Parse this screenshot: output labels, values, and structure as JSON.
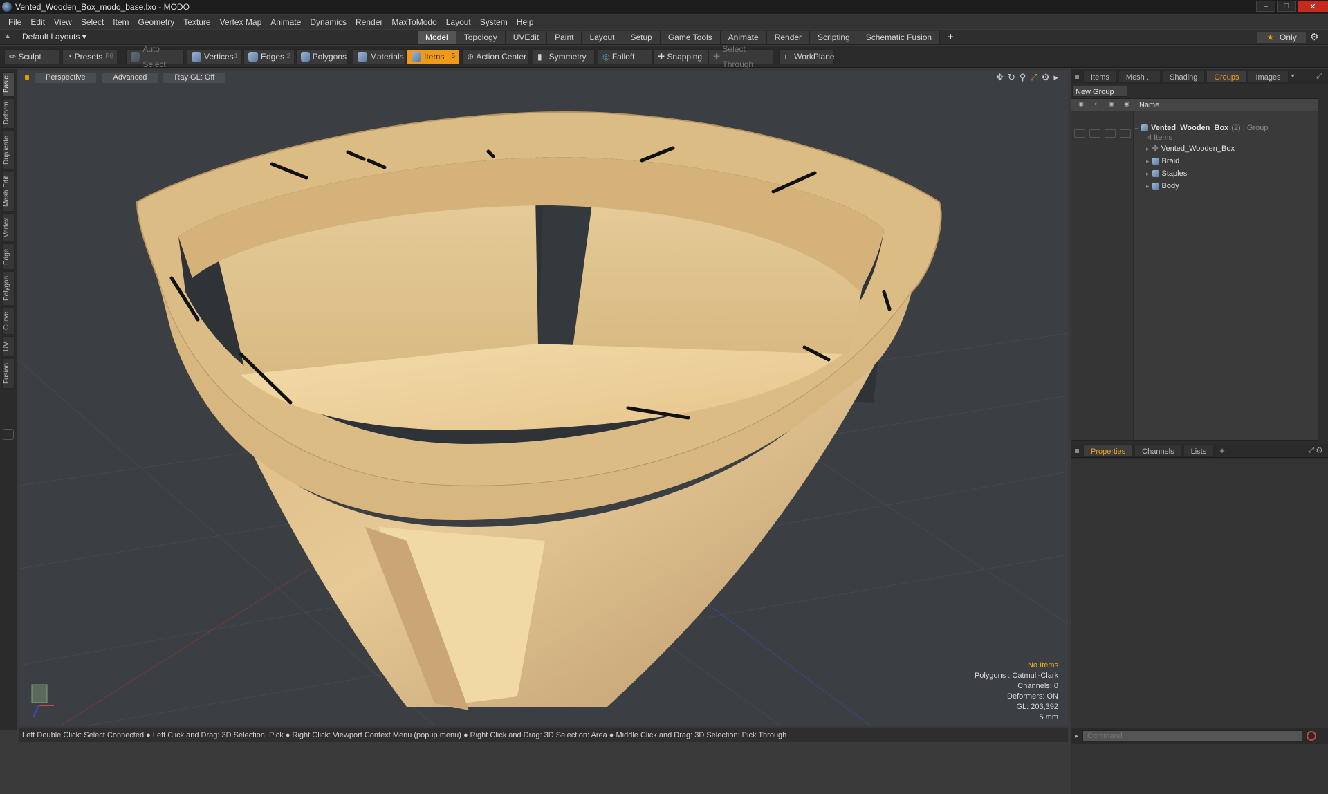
{
  "window": {
    "title": "Vented_Wooden_Box_modo_base.lxo - MODO"
  },
  "menu": [
    "File",
    "Edit",
    "View",
    "Select",
    "Item",
    "Geometry",
    "Texture",
    "Vertex Map",
    "Animate",
    "Dynamics",
    "Render",
    "MaxToModo",
    "Layout",
    "System",
    "Help"
  ],
  "layout": {
    "selector": "Default Layouts",
    "tabs": [
      "Model",
      "Topology",
      "UVEdit",
      "Paint",
      "Layout",
      "Setup",
      "Game Tools",
      "Animate",
      "Render",
      "Scripting",
      "Schematic Fusion"
    ],
    "active_tab": "Model",
    "only_label": "Only"
  },
  "toolbar": {
    "sculpt": "Sculpt",
    "presets": "Presets",
    "presets_key": "F6",
    "auto_select": "Auto Select",
    "vertices": "Vertices",
    "vertices_key": "1",
    "edges": "Edges",
    "edges_key": "2",
    "polygons": "Polygons",
    "materials": "Materials",
    "items": "Items",
    "items_key": "5",
    "action_center": "Action Center",
    "symmetry": "Symmetry",
    "falloff": "Falloff",
    "snapping": "Snapping",
    "select_through": "Select Through",
    "workplane": "WorkPlane"
  },
  "left_tabs": [
    "Basic",
    "Deform",
    "Duplicate",
    "Mesh Edit",
    "Vertex",
    "Edge",
    "Polygon",
    "Curve",
    "UV",
    "Fusion"
  ],
  "viewport": {
    "view": "Perspective",
    "shading": "Advanced",
    "raygl": "Ray GL: Off",
    "stats": {
      "selection": "No Items",
      "polygons": "Polygons : Catmull-Clark",
      "channels": "Channels: 0",
      "deformers": "Deformers: ON",
      "gl": "GL: 203,392",
      "scale": "5 mm"
    }
  },
  "status": "Left Double Click: Select Connected ● Left Click and Drag: 3D Selection: Pick ● Right Click: Viewport Context Menu (popup menu) ● Right Click and Drag: 3D Selection: Area ● Middle Click and Drag: 3D Selection: Pick Through",
  "right_panel": {
    "tabs": [
      "Items",
      "Mesh ...",
      "Shading",
      "Groups",
      "Images"
    ],
    "active_tab": "Groups",
    "new_group": "New Group",
    "name_header": "Name",
    "group": {
      "name": "Vented_Wooden_Box",
      "meta": "(2) : Group",
      "count": "4 Items"
    },
    "children": [
      "Vented_Wooden_Box",
      "Braid",
      "Staples",
      "Body"
    ]
  },
  "props_panel": {
    "tabs": [
      "Properties",
      "Channels",
      "Lists"
    ],
    "active_tab": "Properties"
  },
  "command": {
    "placeholder": "Command"
  },
  "colors": {
    "accent": "#f09a1a",
    "wood": "#e3c48a",
    "viewport_bg": "#3b3f43"
  }
}
